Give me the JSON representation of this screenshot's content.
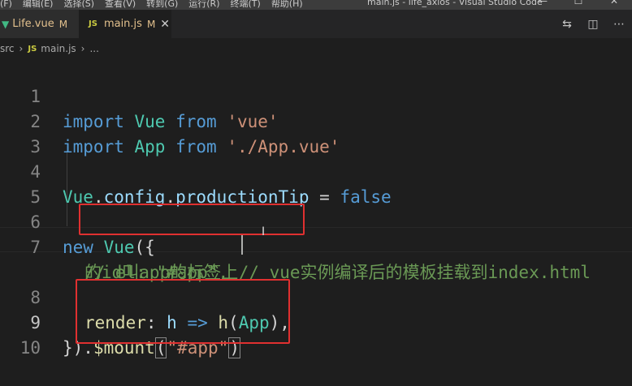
{
  "titlebar": {
    "menu": [
      "(F)",
      "编辑(E)",
      "选择(S)",
      "查看(V)",
      "转到(G)",
      "运行(R)",
      "终端(T)",
      "帮助(H)"
    ],
    "window_title": "main.js - life_axios - Visual Studio Code"
  },
  "tabs": [
    {
      "label": "Life.vue",
      "status": "M",
      "icon": "vue-icon"
    },
    {
      "label": "main.js",
      "status": "M",
      "icon": "js-icon",
      "active": true
    }
  ],
  "breadcrumb": {
    "folder": "src",
    "file": "main.js",
    "ellipsis": "..."
  },
  "editor": {
    "line_numbers": [
      "1",
      "2",
      "3",
      "4",
      "5",
      "6",
      "7",
      "8",
      "9",
      "10"
    ],
    "active_line": "9",
    "lines": {
      "l1": {
        "kw": "import",
        "name": "Vue",
        "from": "from",
        "str": "'vue'"
      },
      "l2": {
        "kw": "import",
        "name": "App",
        "from": "from",
        "str": "'./App.vue'"
      },
      "l4": {
        "obj": "Vue",
        "dot1": ".",
        "config": "config",
        "dot2": ".",
        "prop": "productionTip",
        "eq": " = ",
        "val": "false"
      },
      "l6": {
        "kw": "new",
        "cls": "Vue",
        "punc": "({"
      },
      "l7": {
        "comment_a": "// el: \"#app\", // vue实例编译后的模板挂载到index.html",
        "comment_b": "的id叫app的标签上"
      },
      "l8": {
        "key": "render",
        "colon": ": ",
        "arg": "h",
        "arrow": " => ",
        "fn": "h",
        "open": "(",
        "app": "App",
        "close": "),"
      },
      "l9": {
        "brace": "})",
        "dot": ".",
        "method": "$mount",
        "open": "(",
        "str": "\"#app\"",
        "close": ")"
      }
    }
  },
  "colors": {
    "keyword": "#569cd6",
    "class": "#4ec9b0",
    "string": "#ce9178",
    "comment": "#6a9955",
    "annotation": "#e03030"
  }
}
